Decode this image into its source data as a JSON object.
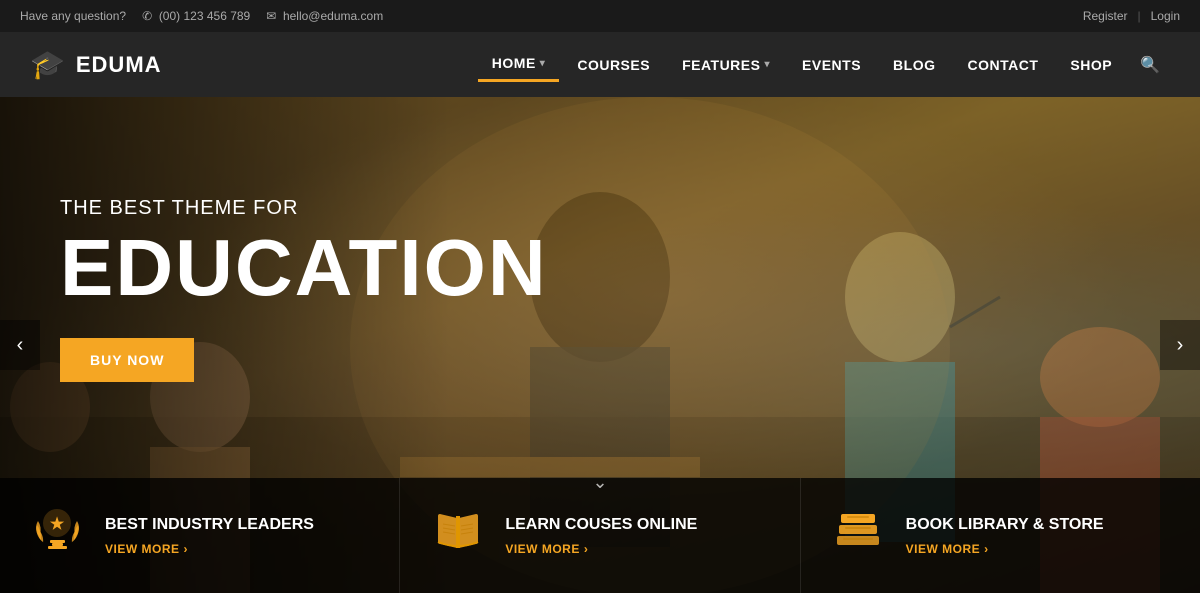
{
  "topbar": {
    "question_label": "Have any question?",
    "phone": "(00) 123 456 789",
    "email": "hello@eduma.com",
    "register": "Register",
    "login": "Login"
  },
  "header": {
    "logo_text": "EDUMA",
    "nav_items": [
      {
        "id": "home",
        "label": "HOME",
        "has_dropdown": true,
        "active": true
      },
      {
        "id": "courses",
        "label": "COURSES",
        "has_dropdown": false,
        "active": false
      },
      {
        "id": "features",
        "label": "FEATURES",
        "has_dropdown": true,
        "active": false
      },
      {
        "id": "events",
        "label": "EVENTS",
        "has_dropdown": false,
        "active": false
      },
      {
        "id": "blog",
        "label": "BLOG",
        "has_dropdown": false,
        "active": false
      },
      {
        "id": "contact",
        "label": "CONTACT",
        "has_dropdown": false,
        "active": false
      },
      {
        "id": "shop",
        "label": "SHOP",
        "has_dropdown": false,
        "active": false
      }
    ]
  },
  "hero": {
    "subtitle": "THE BEST THEME FOR",
    "title": "EDUCATION",
    "button_label": "BUY NOW",
    "prev_arrow": "‹",
    "next_arrow": "›"
  },
  "cards": [
    {
      "id": "industry",
      "title": "BEST INDUSTRY LEADERS",
      "link_label": "VIEW MORE",
      "icon": "award"
    },
    {
      "id": "courses",
      "title": "LEARN COUSES ONLINE",
      "link_label": "VIEW MORE",
      "icon": "book"
    },
    {
      "id": "library",
      "title": "BOOK LIBRARY & STORE",
      "link_label": "VIEW MORE",
      "icon": "library"
    }
  ],
  "colors": {
    "accent": "#f5a623",
    "dark": "#1a1a1a",
    "overlay": "rgba(0,0,0,0.78)"
  }
}
